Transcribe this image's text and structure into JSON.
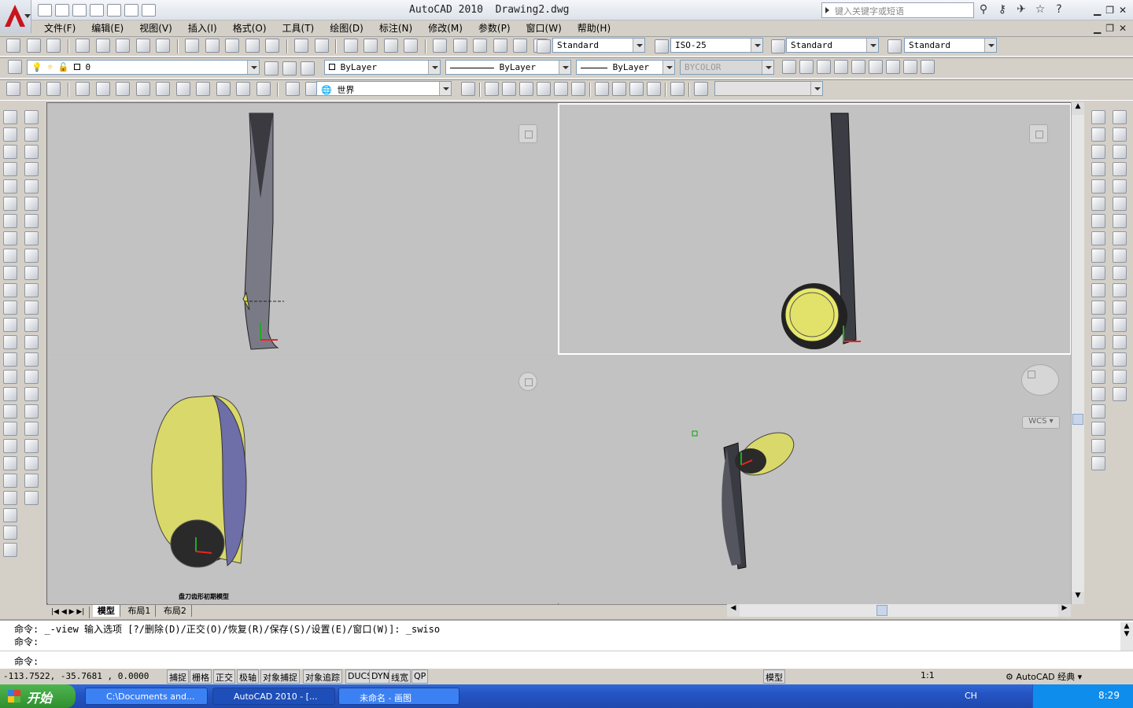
{
  "window": {
    "title": "AutoCAD 2010  Drawing2.dwg",
    "search_placeholder": "键入关键字或短语"
  },
  "menu": [
    "文件(F)",
    "编辑(E)",
    "视图(V)",
    "插入(I)",
    "格式(O)",
    "工具(T)",
    "绘图(D)",
    "标注(N)",
    "修改(M)",
    "参数(P)",
    "窗口(W)",
    "帮助(H)"
  ],
  "styles": {
    "text_style": "Standard",
    "dim_style": "ISO-25",
    "table_style": "Standard",
    "mleader_style": "Standard"
  },
  "layers": {
    "current_layer": "0",
    "color": "ByLayer",
    "linetype": "ByLayer",
    "lineweight": "ByLayer",
    "plotstyle": "BYCOLOR"
  },
  "ucs": {
    "current": "世界"
  },
  "viewports": {
    "wcs_label": "WCS",
    "bottom_left_caption": "盘刀齿形初期模型"
  },
  "layout_tabs": [
    "模型",
    "布局1",
    "布局2"
  ],
  "command": {
    "history_1": "命令: _-view 输入选项 [?/删除(D)/正交(O)/恢复(R)/保存(S)/设置(E)/窗口(W)]: _swiso",
    "history_2": "命令:",
    "prompt": "命令:"
  },
  "status": {
    "coords": "-113.7522, -35.7681 , 0.0000",
    "toggles": [
      "捕捉",
      "栅格",
      "正交",
      "极轴",
      "对象捕捉",
      "对象追踪",
      "DUCS",
      "DYN",
      "线宽",
      "QP"
    ],
    "model_label": "模型",
    "scale": "1:1",
    "workspace": "AutoCAD 经典"
  },
  "taskbar": {
    "start": "开始",
    "tasks": [
      "C:\\Documents and...",
      "AutoCAD 2010 - [...",
      "未命名 - 画图"
    ],
    "lang": "CH",
    "clock": "8:29"
  }
}
